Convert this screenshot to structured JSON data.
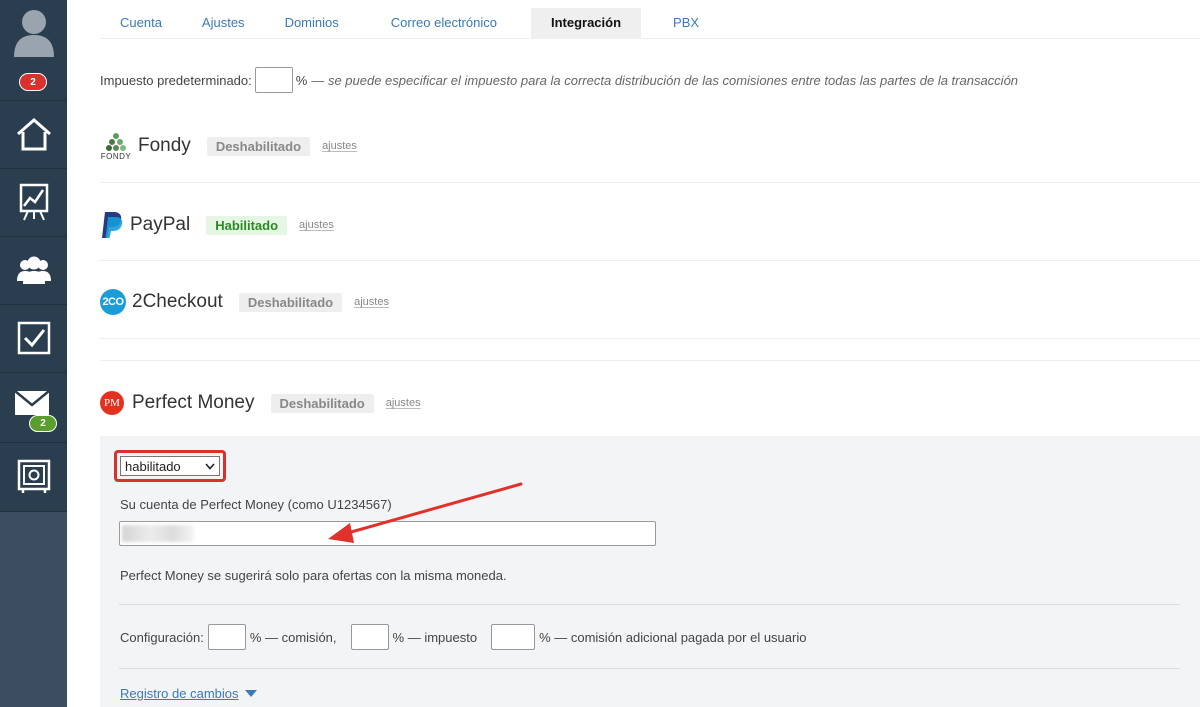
{
  "sidebar": {
    "profile_badge": "2",
    "mail_badge": "2",
    "items": [
      {
        "icon": "home-icon"
      },
      {
        "icon": "chart-icon"
      },
      {
        "icon": "users-icon"
      },
      {
        "icon": "checkbox-icon"
      },
      {
        "icon": "mail-icon"
      },
      {
        "icon": "safe-icon"
      }
    ]
  },
  "tabs": [
    {
      "label": "Cuenta"
    },
    {
      "label": "Ajustes"
    },
    {
      "label": "Dominios"
    },
    {
      "label": "Correo electrónico"
    },
    {
      "label": "Integración",
      "active": true
    },
    {
      "label": "PBX"
    }
  ],
  "tax": {
    "label": "Impuesto predeterminado:",
    "value": "",
    "suffix": "%",
    "note": "— se puede especificar el impuesto para la correcta distribución de las comisiones entre todas las partes de la transacción"
  },
  "gateways": {
    "fondy": {
      "name": "Fondy",
      "logo_text": "FONDY",
      "status": "Deshabilitado",
      "settings": "ajustes"
    },
    "paypal": {
      "name": "PayPal",
      "status": "Habilitado",
      "settings": "ajustes"
    },
    "twocheckout": {
      "name": "2Checkout",
      "logo_text": "2CO",
      "status": "Deshabilitado",
      "settings": "ajustes"
    },
    "perfectmoney": {
      "name": "Perfect Money",
      "logo_text": "PM",
      "status": "Deshabilitado",
      "settings": "ajustes"
    }
  },
  "perfect_money_panel": {
    "status_select": "habilitado",
    "account_label": "Su cuenta de Perfect Money (como U1234567)",
    "note": "Perfect Money se sugerirá solo para ofertas con la misma moneda.",
    "config_label": "Configuración:",
    "commission_suffix": "% — comisión,",
    "tax_suffix": "% — impuesto",
    "extra_suffix": "% — comisión adicional pagada por el usuario",
    "changelog": "Registro de cambios"
  },
  "colors": {
    "sidebar": "#2b3e50",
    "link": "#3a7ab8",
    "highlight": "#d9312d",
    "enabled": "#2a8a22"
  }
}
